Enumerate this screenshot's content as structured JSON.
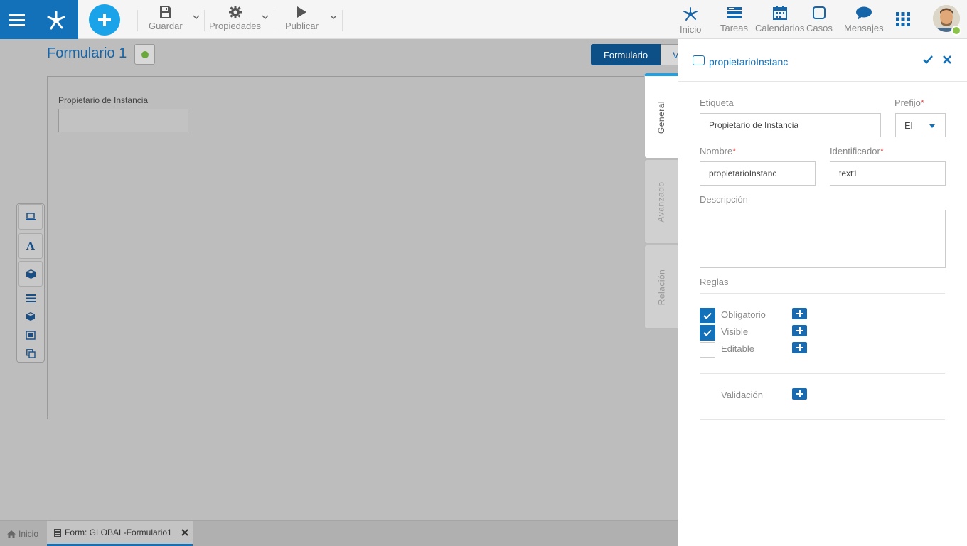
{
  "toolbar": {
    "save": "Guardar",
    "properties": "Propiedades",
    "publish": "Publicar"
  },
  "nav": {
    "home": "Inicio",
    "tasks": "Tareas",
    "calendars": "Calendarios",
    "cases": "Casos",
    "messages": "Mensajes"
  },
  "form": {
    "title": "Formulario 1",
    "status_color": "#6aa83a",
    "view_active": "Formulario",
    "view_other": "V",
    "field_label": "Propietario de Instancia"
  },
  "bottom_tabs": {
    "home": "Inicio",
    "form": "Form: GLOBAL-Formulario1"
  },
  "side_tabs": [
    "General",
    "Avanzado",
    "Relación"
  ],
  "panel": {
    "title": "propietarioInstanc",
    "label_caption": "Etiqueta",
    "label_value": "Propietario de Instancia",
    "prefix_caption": "Prefijo",
    "prefix_value": "El",
    "name_caption": "Nombre",
    "name_value": "propietarioInstanc",
    "id_caption": "Identificador",
    "id_value": "text1",
    "required_mark": "*",
    "desc_caption": "Descripción",
    "desc_value": "",
    "rules_caption": "Reglas",
    "rules": [
      {
        "label": "Obligatorio",
        "checked": true
      },
      {
        "label": "Visible",
        "checked": true
      },
      {
        "label": "Editable",
        "checked": false
      }
    ],
    "validation": "Validación"
  },
  "colors": {
    "brand": "#1371b9",
    "accent": "#1aa3e8"
  }
}
